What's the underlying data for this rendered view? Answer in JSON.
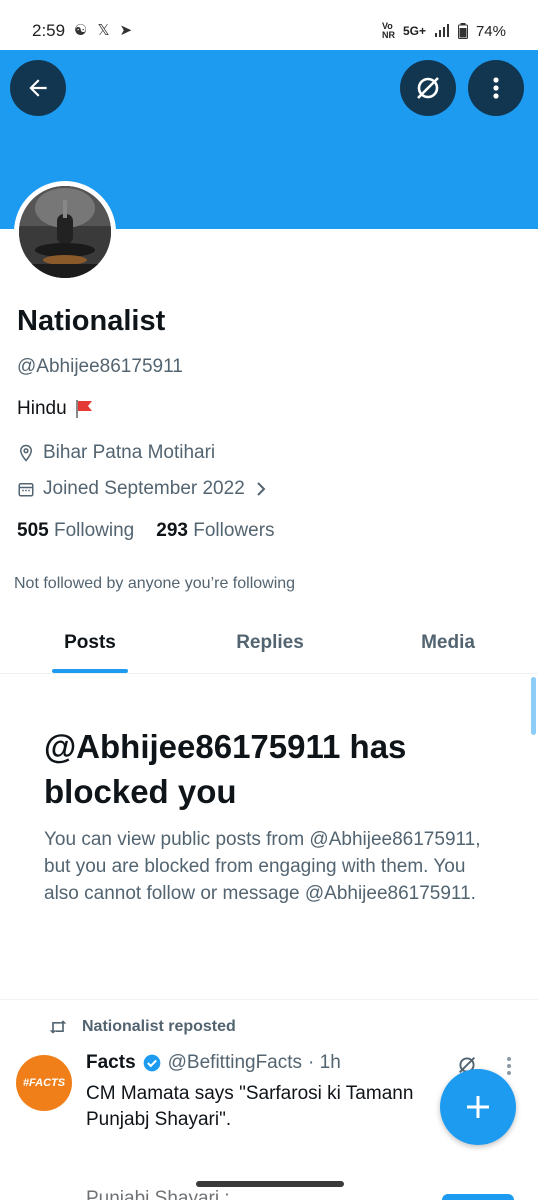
{
  "status_bar": {
    "time": "2:59",
    "network": "5G+",
    "battery": "74%"
  },
  "profile": {
    "name": "Nationalist",
    "handle": "@Abhijee86175911",
    "bio": "Hindu",
    "location": "Bihar Patna Motihari",
    "joined": "Joined September 2022",
    "following_count": "505",
    "following_label": "Following",
    "followers_count": "293",
    "followers_label": "Followers",
    "not_followed": "Not followed by anyone you’re following"
  },
  "tabs": [
    {
      "label": "Posts",
      "active": true
    },
    {
      "label": "Replies",
      "active": false
    },
    {
      "label": "Media",
      "active": false
    }
  ],
  "blocked": {
    "title": "@Abhijee86175911 has blocked you",
    "description": "You can view public posts from @Abhijee86175911, but you are blocked from engaging with them. You also cannot follow or message @Abhijee86175911."
  },
  "tweet": {
    "repost_label": "Nationalist reposted",
    "author_name": "Facts",
    "author_handle": "@BefittingFacts",
    "time": "· 1h",
    "avatar_text": "#FACTS",
    "text_line1": "CM Mamata says \"Sarfarosi ki Tamann",
    "text_line2": "Punjabj Shayari\".",
    "cut_text": "Punjabi Shayari :"
  },
  "colors": {
    "accent": "#1d9bf0",
    "text": "#0f1419",
    "muted": "#536471"
  }
}
